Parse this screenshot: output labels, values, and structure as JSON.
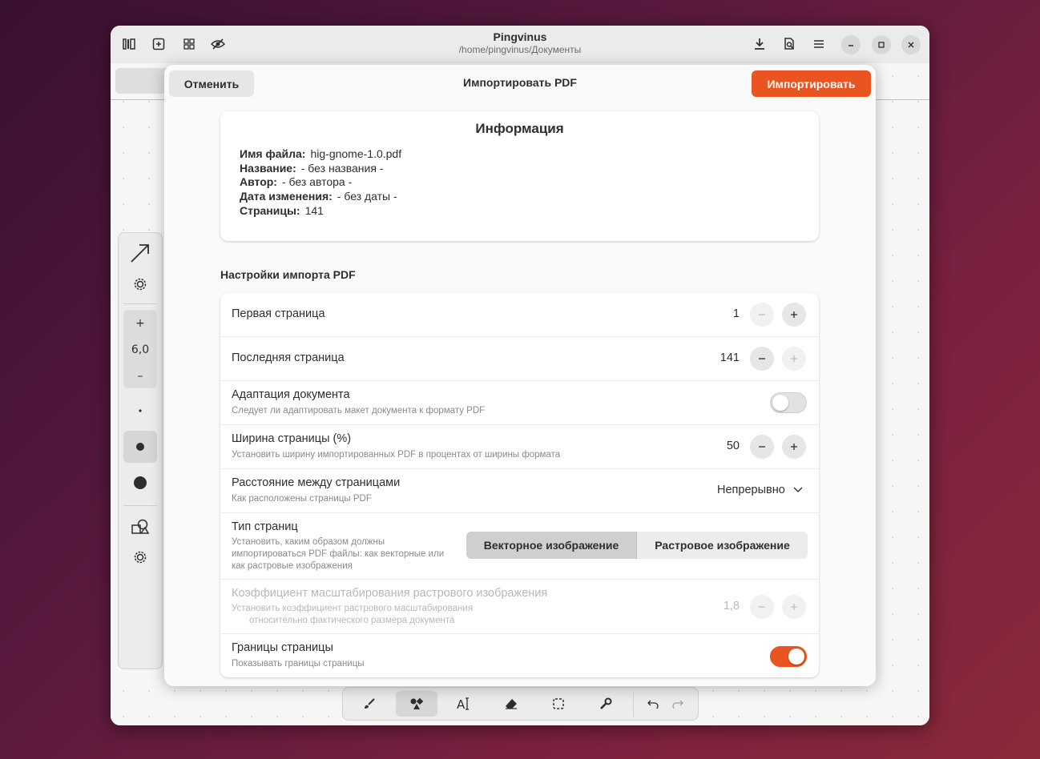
{
  "window": {
    "title": "Pingvinus",
    "subtitle": "/home/pingvinus/Документы"
  },
  "headerbar": {
    "left_icons": [
      "sidebar-icon",
      "new-document-icon",
      "overview-icon",
      "hide-icon"
    ],
    "right_icons": [
      "download-icon",
      "document-search-icon",
      "menu-icon"
    ],
    "window_controls": [
      "minimize-icon",
      "maximize-icon",
      "close-icon"
    ]
  },
  "left_toolbar": {
    "stroke_width_value": "6,0",
    "plus": "+",
    "minus": "–"
  },
  "bottom_toolbar": {
    "tools": [
      "brush-icon",
      "shapes-icon",
      "text-icon",
      "eraser-icon",
      "selector-icon",
      "tools-icon"
    ],
    "active_tool": "shapes-icon",
    "undo": "undo-icon",
    "redo": "redo-icon"
  },
  "dialog": {
    "cancel_label": "Отменить",
    "title": "Импортировать PDF",
    "import_label": "Импортировать",
    "accent_color": "#e95420",
    "info": {
      "heading": "Информация",
      "file_name_label": "Имя файла:",
      "file_name_value": "hig-gnome-1.0.pdf",
      "title_label": "Название:",
      "title_value": "- без названия -",
      "author_label": "Автор:",
      "author_value": "- без автора -",
      "modified_label": "Дата изменения:",
      "modified_value": "- без даты -",
      "pages_label": "Страницы:",
      "pages_value": "141"
    },
    "settings_heading": "Настройки импорта PDF",
    "settings": {
      "first_page": {
        "title": "Первая страница",
        "value": "1"
      },
      "last_page": {
        "title": "Последняя страница",
        "value": "141"
      },
      "adapt": {
        "title": "Адаптация документа",
        "subtitle": "Следует ли адаптировать макет документа к формату PDF",
        "enabled": false
      },
      "page_width": {
        "title": "Ширина страницы (%)",
        "subtitle": "Установить ширину импортированных PDF в процентах от ширины формата",
        "value": "50"
      },
      "page_spacing": {
        "title": "Расстояние между страницами",
        "subtitle": "Как расположены страницы PDF",
        "value": "Непрерывно"
      },
      "page_type": {
        "title": "Тип страниц",
        "subtitle_line1": "Установить, каким образом должны",
        "subtitle_line2": "импортироваться PDF файлы: как векторные или",
        "subtitle_line3": "как растровые изображения",
        "option_vector": "Векторное изображение",
        "option_raster": "Растровое изображение",
        "selected": "Векторное изображение"
      },
      "raster_scale": {
        "title": "Коэффициент масштабирования растрового изображения",
        "subtitle_line1": "Установить коэффициент растрового масштабирования",
        "subtitle_line2": "относительно фактического размера документа",
        "value": "1,8"
      },
      "page_borders": {
        "title": "Границы страницы",
        "subtitle": "Показывать границы страницы",
        "enabled": true
      }
    }
  }
}
